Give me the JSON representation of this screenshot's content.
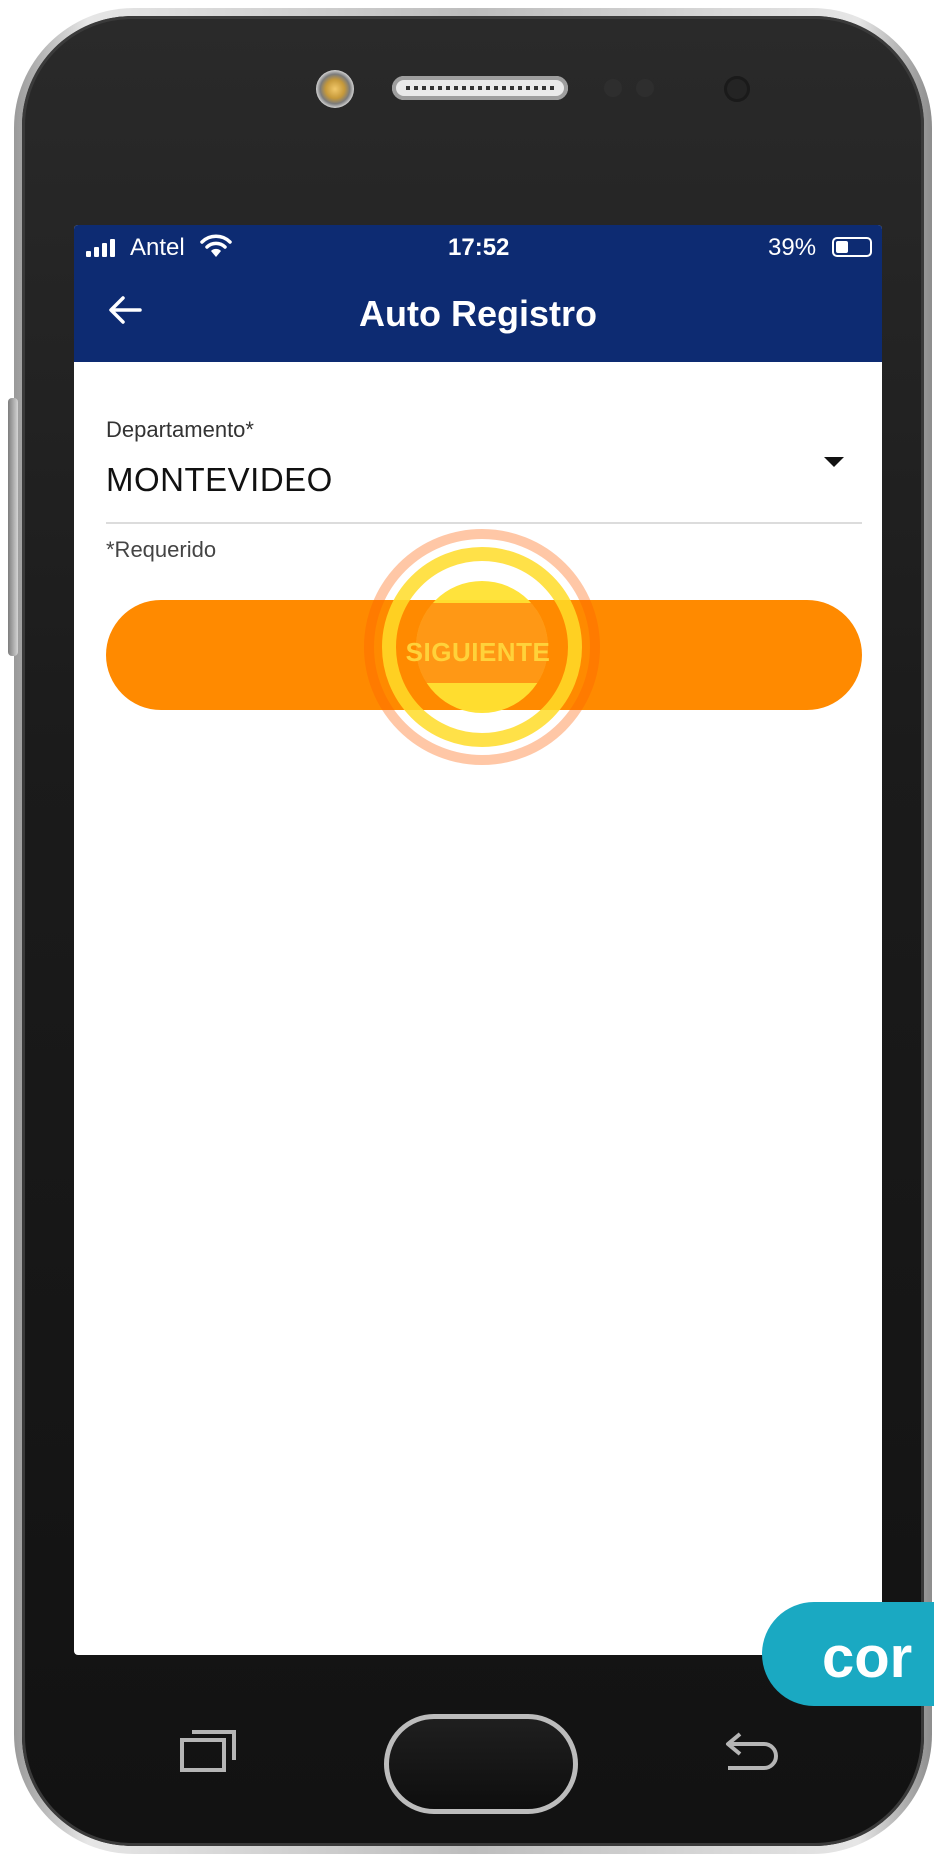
{
  "status_bar": {
    "carrier": "Antel",
    "time": "17:52",
    "battery_percent_label": "39%",
    "battery_level": 0.39
  },
  "header": {
    "title": "Auto Registro",
    "back_icon": "arrow-left-icon"
  },
  "form": {
    "department_field": {
      "label": "Departamento*",
      "value": "MONTEVIDEO",
      "icon": "caret-down-icon"
    },
    "required_note": "*Requerido",
    "next_button_label": "SIGUIENTE"
  },
  "overlay": {
    "badge_text": "cor"
  },
  "colors": {
    "header_bg": "#0d2b72",
    "button_bg": "#ff8a00",
    "button_text": "#ffd23a",
    "tap_highlight": "#ffe032",
    "badge_bg": "#1aa9c2"
  }
}
